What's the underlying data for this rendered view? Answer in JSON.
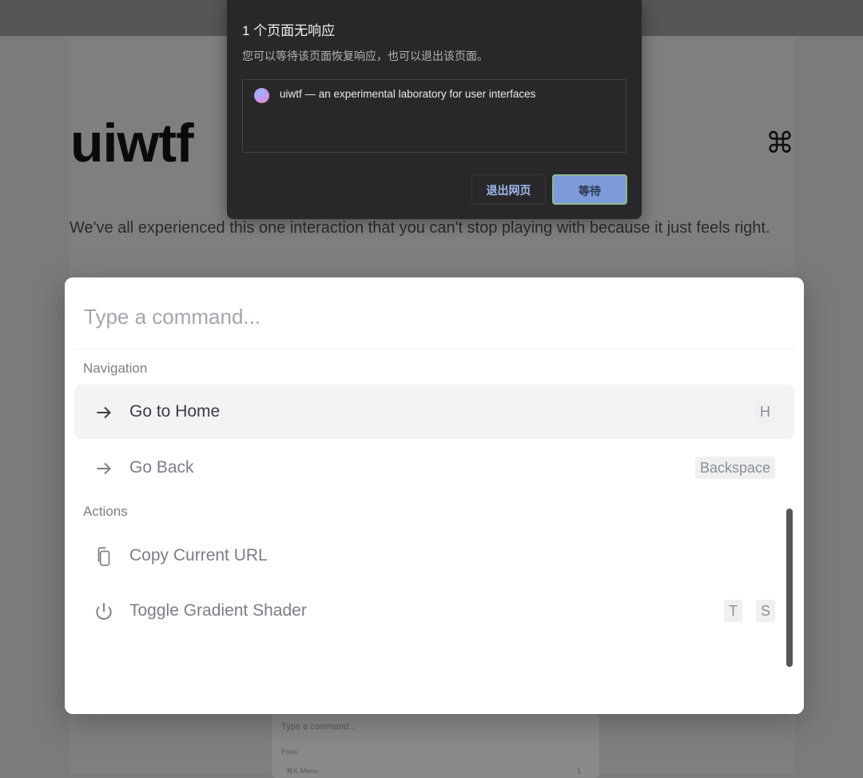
{
  "page": {
    "logo": "uiwtf",
    "shortcut_icon": "⌘",
    "intro": "We've all experienced this one interaction that you can't stop playing with because it just feels right."
  },
  "preview": {
    "placeholder": "Type a command...",
    "group": "Posts",
    "item": "⌘K Menu",
    "shortcut": "1"
  },
  "palette": {
    "placeholder": "Type a command...",
    "groups": [
      {
        "label": "Navigation",
        "items": [
          {
            "label": "Go to Home",
            "icon": "arrow-right-icon",
            "keys": [
              "H"
            ],
            "active": true
          },
          {
            "label": "Go Back",
            "icon": "arrow-right-icon",
            "keys": [
              "Backspace"
            ]
          }
        ]
      },
      {
        "label": "Actions",
        "items": [
          {
            "label": "Copy Current URL",
            "icon": "copy-icon",
            "keys": []
          },
          {
            "label": "Toggle Gradient Shader",
            "icon": "power-icon",
            "keys": [
              "T",
              "S"
            ]
          }
        ]
      }
    ]
  },
  "dialog": {
    "title": "1 个页面无响应",
    "subtitle": "您可以等待该页面恢复响应，也可以退出该页面。",
    "page_title": "uiwtf — an experimental laboratory for user interfaces",
    "exit_label": "退出网页",
    "wait_label": "等待",
    "accent": "#7c9bd8"
  }
}
